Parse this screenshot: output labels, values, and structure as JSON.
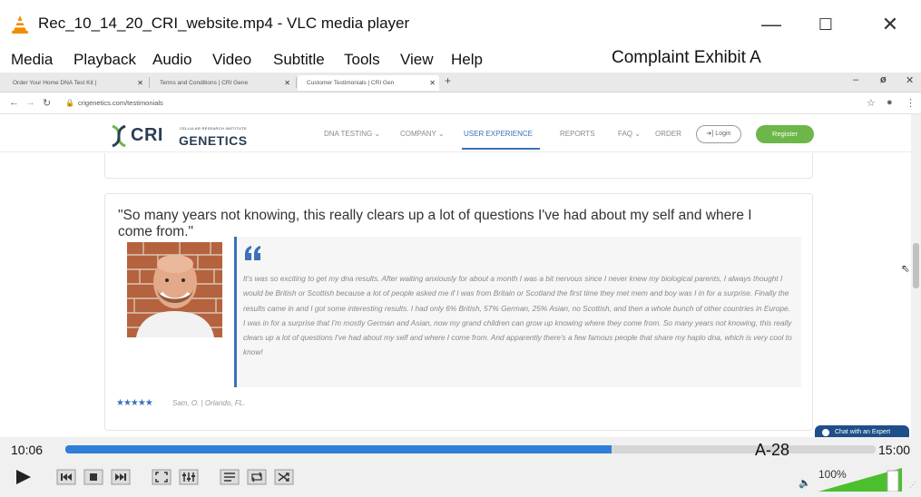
{
  "window": {
    "title": "Rec_10_14_20_CRI_website.mp4 - VLC media player",
    "minimize": "—",
    "maximize": "☐",
    "close": "✕"
  },
  "menu": [
    "Media",
    "Playback",
    "Audio",
    "Video",
    "Subtitle",
    "Tools",
    "View",
    "Help"
  ],
  "exhibit_label": "Complaint Exhibit A",
  "browser": {
    "tabs": [
      {
        "title": "Order Your Home DNA Test Kit |"
      },
      {
        "title": "Terms and Conditions | CRI Gene"
      },
      {
        "title": "Customer Testimonials | CRI Gen"
      }
    ],
    "url": "crigenetics.com/testimonials"
  },
  "site": {
    "logo_main": "CRI",
    "logo_tail": "GENETICS",
    "logo_sub": "CELLULAR RESEARCH INSTITUTE",
    "nav": [
      {
        "label": "DNA TESTING ⌄",
        "active": false
      },
      {
        "label": "COMPANY ⌄",
        "active": false
      },
      {
        "label": "USER EXPERIENCE",
        "active": true
      },
      {
        "label": "REPORTS",
        "active": false
      },
      {
        "label": "FAQ ⌄",
        "active": false
      },
      {
        "label": "ORDER",
        "active": false
      }
    ],
    "login": "➜] Login",
    "register": "Register"
  },
  "testimonial": {
    "headline": "\"So many years not knowing, this really clears up a lot of questions I've had about my self and where I come from.\"",
    "quote_mark": "66",
    "body": "It's was so exciting to get my dna results. After waiting anxiously for about a month I was a bit nervous since I never knew my biological parents, I always thought I would be British or Scottish because a lot of people asked me if I was from Britain or Scotland the first time they met mem and boy was I in for a surprise. Finally the results came in and I got some interesting results. I had only 6% British, 57% German, 25% Asian, no Scottish, and then a whole bunch of other countries in Europe. I was in for a surprise that I'm mostly German and Asian, now my grand children can grow up knowing where they come from. So many years not knowing, this really clears up a lot of questions I've had about my self and where I come from. And apparently there's a few famous people that share my haplo dna, which is very cool to know!",
    "stars": "★★★★★",
    "rating": 5,
    "author": "Sam, O. | Orlando, FL."
  },
  "chat_label": "Chat with an Expert",
  "player": {
    "elapsed": "10:06",
    "total": "15:00",
    "progress": 0.674,
    "exhibit_number": "A-28",
    "volume_label": "100%",
    "volume": 1.0
  },
  "colors": {
    "brand_blue": "#3a72b8",
    "register_green": "#6db64a",
    "vlc_orange": "#f28c00",
    "seek_blue": "#2f7ed8",
    "volume_green": "#4cbf2f"
  }
}
